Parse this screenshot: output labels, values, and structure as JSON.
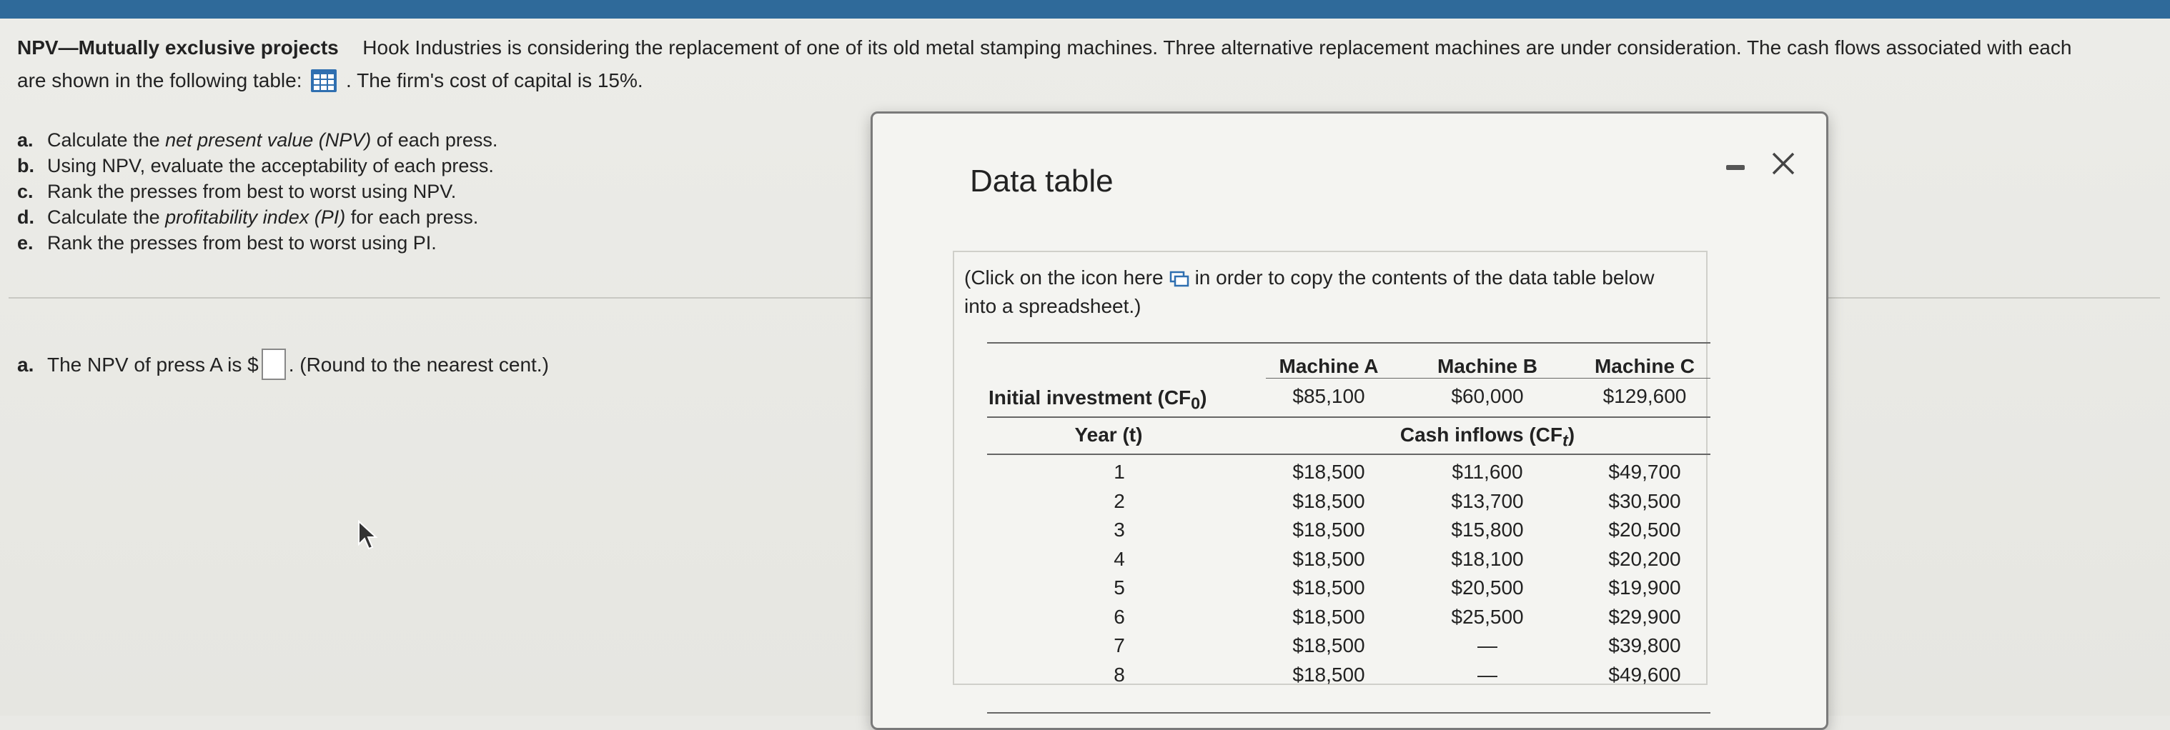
{
  "problem": {
    "title": "NPV—Mutually exclusive projects",
    "text_line1": "Hook Industries is considering the replacement of one of its old metal stamping machines.  Three alternative replacement machines are under consideration.  The cash flows associated with each",
    "text_line2_before": "are shown in the following table:",
    "text_line2_after": ".  The firm's cost of capital is 15%."
  },
  "tasks": [
    {
      "letter": "a.",
      "pre": "Calculate the ",
      "em": "net present value (NPV)",
      "post": " of each press."
    },
    {
      "letter": "b.",
      "pre": "Using NPV, evaluate the acceptability of each press.",
      "em": "",
      "post": ""
    },
    {
      "letter": "c.",
      "pre": "Rank the presses from best to worst using NPV.",
      "em": "",
      "post": ""
    },
    {
      "letter": "d.",
      "pre": "Calculate the ",
      "em": "profitability index (PI)",
      "post": " for each press."
    },
    {
      "letter": "e.",
      "pre": "Rank the presses from best to worst using PI.",
      "em": "",
      "post": ""
    }
  ],
  "answer": {
    "letter": "a.",
    "prefix": "The NPV of press A is $",
    "suffix": ".  (Round to the nearest cent.)"
  },
  "modal": {
    "title": "Data table",
    "copy_note_before": "(Click on the icon here",
    "copy_note_after": "in order to copy the contents of the data table below into a spreadsheet.)"
  },
  "table": {
    "machines": [
      "Machine A",
      "Machine B",
      "Machine C"
    ],
    "initial_label": "Initial investment (CF",
    "initial_sub": "0",
    "initial_values": [
      "$85,100",
      "$60,000",
      "$129,600"
    ],
    "year_label": "Year (t)",
    "cash_label": "Cash inflows (CF",
    "cash_sub": "t",
    "years": [
      "1",
      "2",
      "3",
      "4",
      "5",
      "6",
      "7",
      "8"
    ],
    "machine_a": [
      "$18,500",
      "$18,500",
      "$18,500",
      "$18,500",
      "$18,500",
      "$18,500",
      "$18,500",
      "$18,500"
    ],
    "machine_b": [
      "$11,600",
      "$13,700",
      "$15,800",
      "$18,100",
      "$20,500",
      "$25,500",
      "—",
      "—"
    ],
    "machine_c": [
      "$49,700",
      "$30,500",
      "$20,500",
      "$20,200",
      "$19,900",
      "$29,900",
      "$39,800",
      "$49,600"
    ]
  },
  "icons": [
    "table-grid-icon",
    "copy-icon",
    "minimize-icon",
    "close-icon",
    "mouse-cursor-icon"
  ],
  "colors": {
    "topbar": "#2f6a9a",
    "grid_icon": "#2f6fb0"
  }
}
